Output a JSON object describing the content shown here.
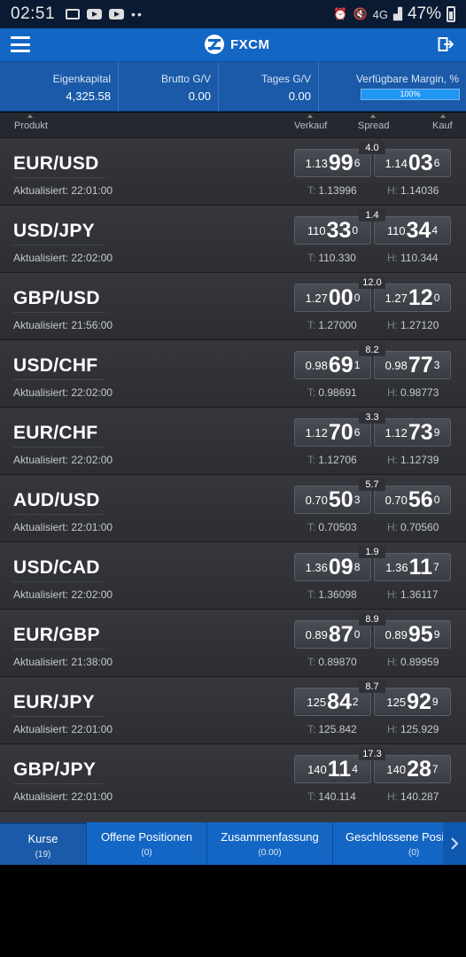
{
  "status_bar": {
    "time": "02:51",
    "network": "4G",
    "battery": "47%"
  },
  "header": {
    "title": "FXCM"
  },
  "summary": [
    {
      "label": "Eigenkapital",
      "value": "4,325.58"
    },
    {
      "label": "Brutto G/V",
      "value": "0.00"
    },
    {
      "label": "Tages G/V",
      "value": "0.00"
    },
    {
      "label": "Verfügbare Margin, %",
      "value": "100%",
      "level_percent": 100
    }
  ],
  "columns": {
    "product": "Produkt",
    "sell": "Verkauf",
    "spread": "Spread",
    "buy": "Kauf"
  },
  "rows": [
    {
      "pair": "EUR/USD",
      "updated": "Aktualisiert: 22:01:00",
      "spread": "4.0",
      "sell": {
        "small": "1.13",
        "big": "99",
        "pip": "6"
      },
      "buy": {
        "small": "1.14",
        "big": "03",
        "pip": "6"
      },
      "low_label": "T:",
      "low": "1.13996",
      "high_label": "H:",
      "high": "1.14036"
    },
    {
      "pair": "USD/JPY",
      "updated": "Aktualisiert: 22:02:00",
      "spread": "1.4",
      "sell": {
        "small": "110",
        "big": "33",
        "pip": "0"
      },
      "buy": {
        "small": "110",
        "big": "34",
        "pip": "4"
      },
      "low_label": "T:",
      "low": "110.330",
      "high_label": "H:",
      "high": "110.344"
    },
    {
      "pair": "GBP/USD",
      "updated": "Aktualisiert: 21:56:00",
      "spread": "12.0",
      "sell": {
        "small": "1.27",
        "big": "00",
        "pip": "0"
      },
      "buy": {
        "small": "1.27",
        "big": "12",
        "pip": "0"
      },
      "low_label": "T:",
      "low": "1.27000",
      "high_label": "H:",
      "high": "1.27120"
    },
    {
      "pair": "USD/CHF",
      "updated": "Aktualisiert: 22:02:00",
      "spread": "8.2",
      "sell": {
        "small": "0.98",
        "big": "69",
        "pip": "1"
      },
      "buy": {
        "small": "0.98",
        "big": "77",
        "pip": "3"
      },
      "low_label": "T:",
      "low": "0.98691",
      "high_label": "H:",
      "high": "0.98773"
    },
    {
      "pair": "EUR/CHF",
      "updated": "Aktualisiert: 22:02:00",
      "spread": "3.3",
      "sell": {
        "small": "1.12",
        "big": "70",
        "pip": "6"
      },
      "buy": {
        "small": "1.12",
        "big": "73",
        "pip": "9"
      },
      "low_label": "T:",
      "low": "1.12706",
      "high_label": "H:",
      "high": "1.12739"
    },
    {
      "pair": "AUD/USD",
      "updated": "Aktualisiert: 22:01:00",
      "spread": "5.7",
      "sell": {
        "small": "0.70",
        "big": "50",
        "pip": "3"
      },
      "buy": {
        "small": "0.70",
        "big": "56",
        "pip": "0"
      },
      "low_label": "T:",
      "low": "0.70503",
      "high_label": "H:",
      "high": "0.70560"
    },
    {
      "pair": "USD/CAD",
      "updated": "Aktualisiert: 22:02:00",
      "spread": "1.9",
      "sell": {
        "small": "1.36",
        "big": "09",
        "pip": "8"
      },
      "buy": {
        "small": "1.36",
        "big": "11",
        "pip": "7"
      },
      "low_label": "T:",
      "low": "1.36098",
      "high_label": "H:",
      "high": "1.36117"
    },
    {
      "pair": "EUR/GBP",
      "updated": "Aktualisiert: 21:38:00",
      "spread": "8.9",
      "sell": {
        "small": "0.89",
        "big": "87",
        "pip": "0"
      },
      "buy": {
        "small": "0.89",
        "big": "95",
        "pip": "9"
      },
      "low_label": "T:",
      "low": "0.89870",
      "high_label": "H:",
      "high": "0.89959"
    },
    {
      "pair": "EUR/JPY",
      "updated": "Aktualisiert: 22:01:00",
      "spread": "8.7",
      "sell": {
        "small": "125",
        "big": "84",
        "pip": "2"
      },
      "buy": {
        "small": "125",
        "big": "92",
        "pip": "9"
      },
      "low_label": "T:",
      "low": "125.842",
      "high_label": "H:",
      "high": "125.929"
    },
    {
      "pair": "GBP/JPY",
      "updated": "Aktualisiert: 22:01:00",
      "spread": "17.3",
      "sell": {
        "small": "140",
        "big": "11",
        "pip": "4"
      },
      "buy": {
        "small": "140",
        "big": "28",
        "pip": "7"
      },
      "low_label": "T:",
      "low": "140.114",
      "high_label": "H:",
      "high": "140.287"
    }
  ],
  "tabs": [
    {
      "label": "Kurse",
      "count": "(19)",
      "active": true
    },
    {
      "label": "Offene Positionen",
      "count": "(0)",
      "active": false
    },
    {
      "label": "Zusammenfassung",
      "count": "(0.00)",
      "active": false
    },
    {
      "label": "Geschlossene Positionen",
      "count": "(0)",
      "active": false
    }
  ]
}
